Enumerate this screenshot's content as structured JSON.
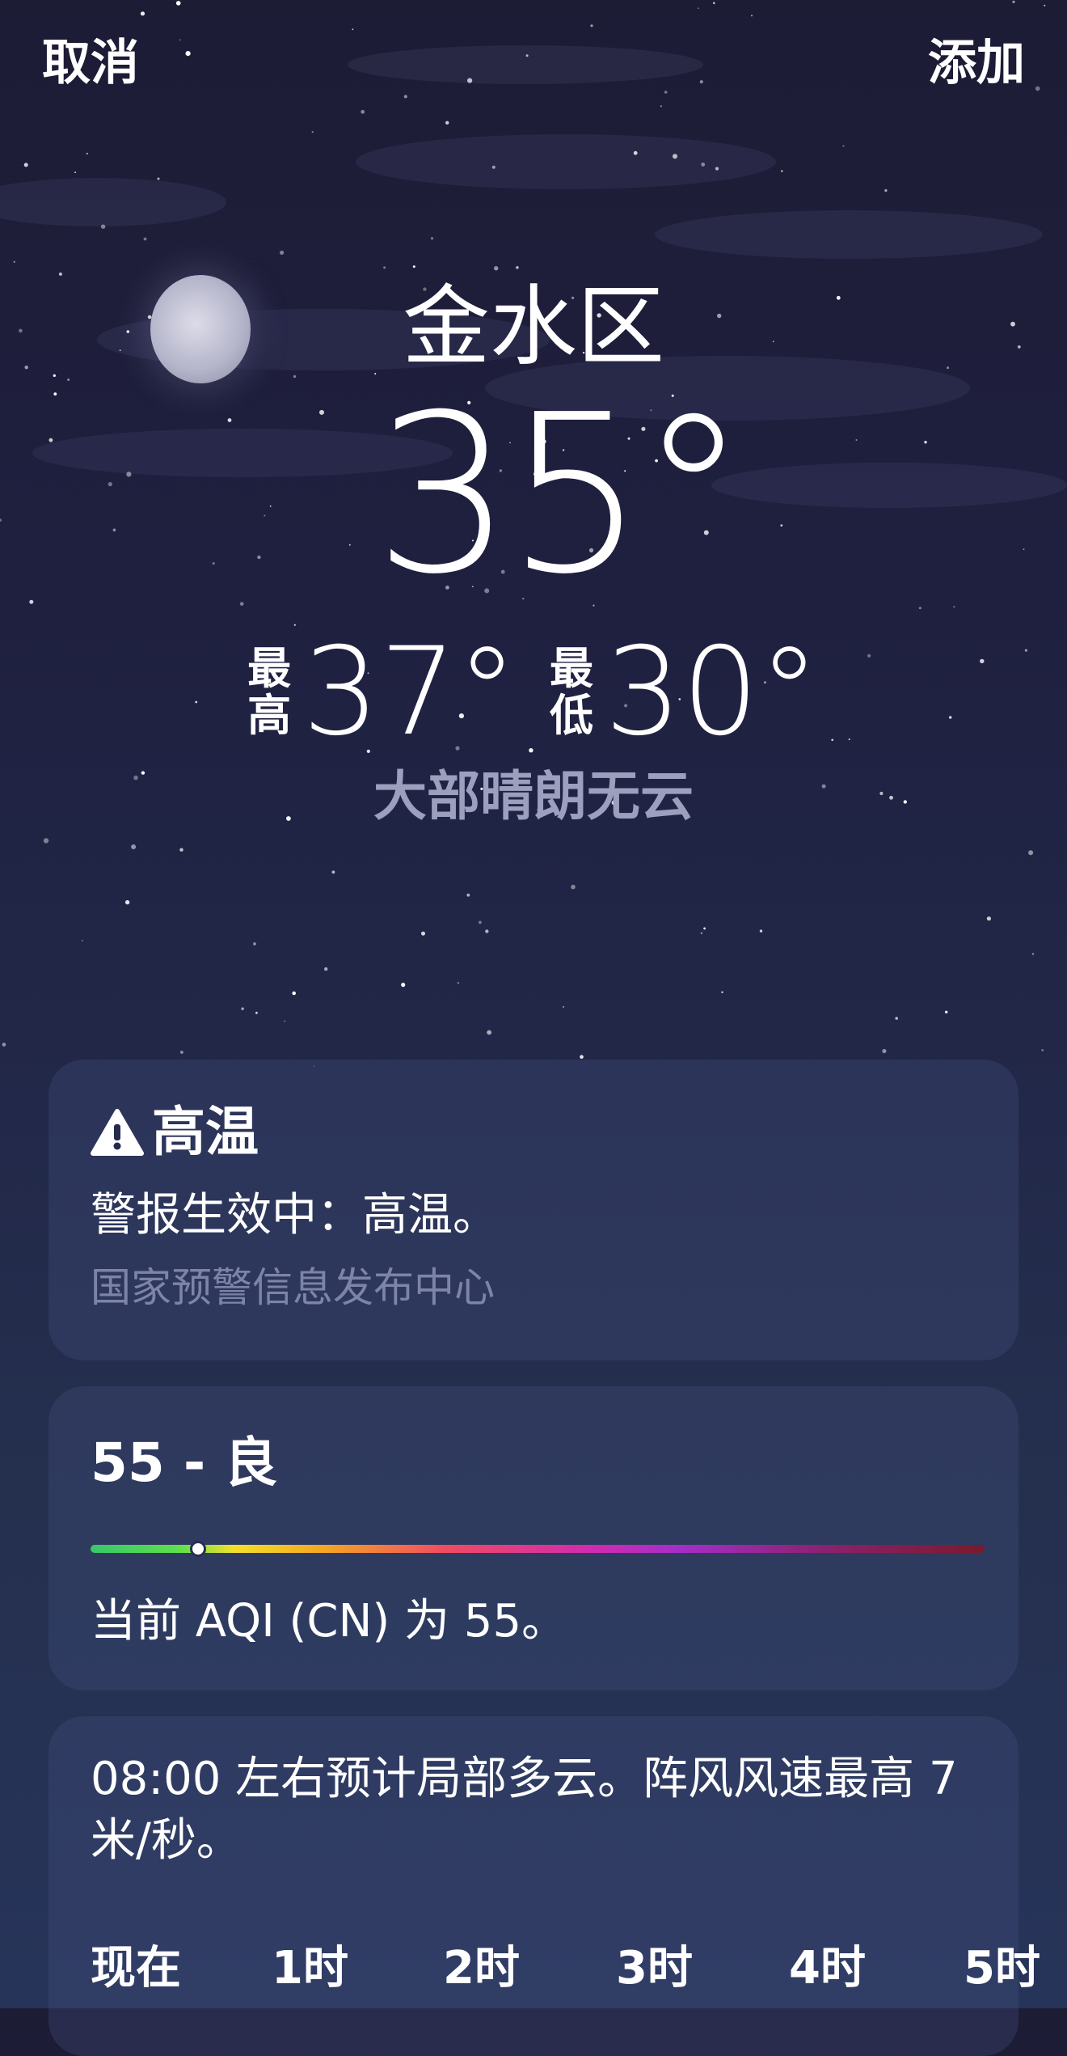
{
  "topbar": {
    "cancel": "取消",
    "add": "添加"
  },
  "weather": {
    "location": "金水区",
    "temperature": "35°",
    "high_label": "最高",
    "high_label_chars": [
      "最",
      "高"
    ],
    "high": "37°",
    "low_label": "最低",
    "low_label_chars": [
      "最",
      "低"
    ],
    "low": "30°",
    "condition": "大部晴朗无云"
  },
  "alert": {
    "icon": "warning-icon",
    "title": "高温",
    "body": "警报生效中：高温。",
    "source": "国家预警信息发布中心"
  },
  "aqi": {
    "value_label": "55 - 良",
    "value": 55,
    "indicator_fraction": 0.12,
    "description": "当前 AQI (CN) 为 55。"
  },
  "forecast": {
    "summary": "08:00 左右预计局部多云。阵风风速最高 7 米/秒。",
    "hours": [
      "现在",
      "1时",
      "2时",
      "3时",
      "4时",
      "5时"
    ]
  },
  "colors": {
    "background_top": "#1d1c35",
    "background_bottom": "#27345a",
    "condition_text": "#9d9fbf",
    "source_text": "#7d84a6"
  }
}
